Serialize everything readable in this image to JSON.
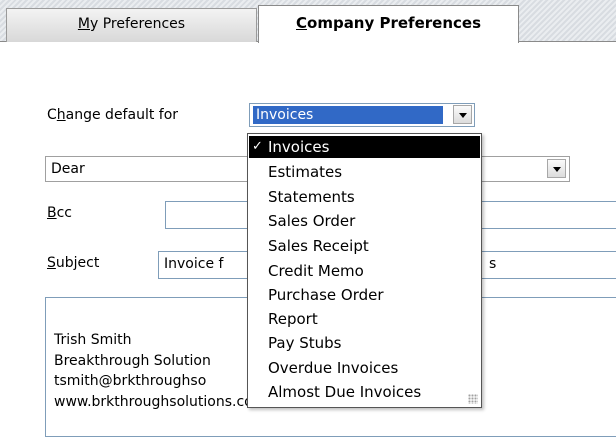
{
  "tabs": [
    {
      "label_prefix": "",
      "label_accel": "M",
      "label_rest": "y Preferences",
      "active": false
    },
    {
      "label_prefix": "",
      "label_accel": "C",
      "label_rest": "ompany Preferences",
      "active": true
    }
  ],
  "change_default": {
    "label_pre": "C",
    "label_accel": "h",
    "label_post": "ange default for",
    "selected": "Invoices"
  },
  "salutation": {
    "value": "Dear"
  },
  "bcc": {
    "label_accel": "B",
    "label_rest": "cc",
    "value": ""
  },
  "subject": {
    "label_accel": "S",
    "label_rest": "ubject",
    "value_left": "Invoice f",
    "value_right": "s"
  },
  "dropdown": {
    "items": [
      "Invoices",
      "Estimates",
      "Statements",
      "Sales Order",
      "Sales Receipt",
      "Credit Memo",
      "Purchase Order",
      "Report",
      "Pay Stubs",
      "Overdue Invoices",
      "Almost Due Invoices"
    ],
    "selected_index": 0,
    "check_glyph": "✓"
  },
  "signature": {
    "lines": [
      "Trish Smith",
      "Breakthrough Solution",
      "tsmith@brkthroughso",
      "www.brkthroughsolutions.com"
    ]
  },
  "colors": {
    "selection": "#3169c6",
    "border": "#7f9db9"
  }
}
